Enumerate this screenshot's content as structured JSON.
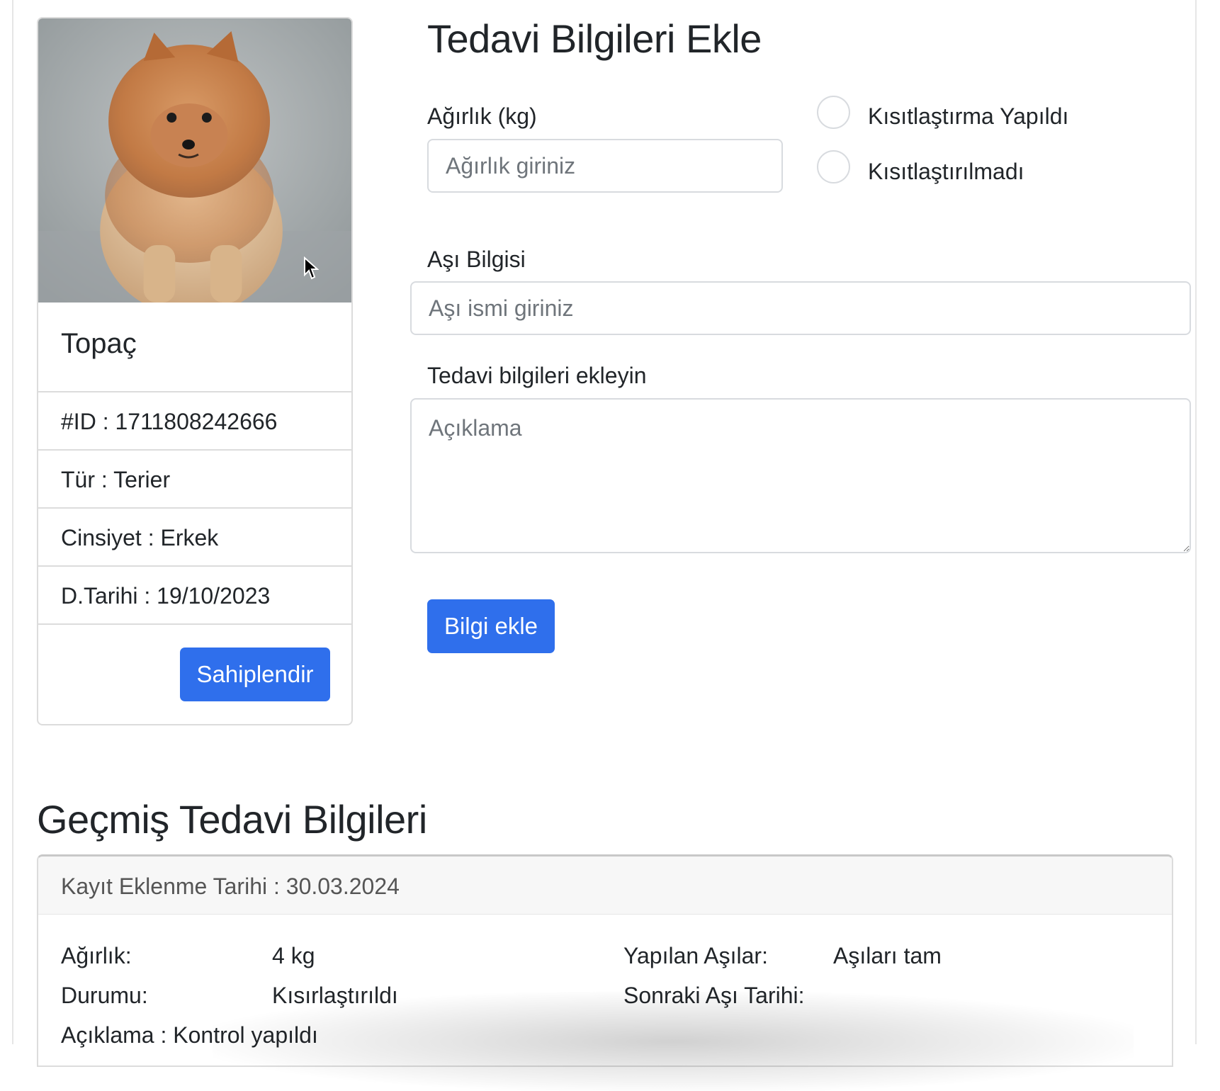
{
  "pet": {
    "name": "Topaç",
    "id_text": "#ID : 1711808242666",
    "type_text": "Tür : Terier",
    "gender_text": "Cinsiyet : Erkek",
    "birth_text": "D.Tarihi : 19/10/2023",
    "adopt_button": "Sahiplendir"
  },
  "form": {
    "title": "Tedavi Bilgileri Ekle",
    "weight_label": "Ağırlık (kg)",
    "weight_placeholder": "Ağırlık giriniz",
    "radio_neutered": "Kısıtlaştırma Yapıldı",
    "radio_not_neutered": "Kısıtlaştırılmadı",
    "vaccine_label": "Aşı Bilgisi",
    "vaccine_placeholder": "Aşı ismi giriniz",
    "treatment_label": "Tedavi bilgileri ekleyin",
    "description_placeholder": "Açıklama",
    "submit_button": "Bilgi ekle"
  },
  "history": {
    "title": "Geçmiş Tedavi Bilgileri",
    "record": {
      "date_text": "Kayıt Eklenme Tarihi : 30.03.2024",
      "weight_label": "Ağırlık:",
      "weight_value": "4 kg",
      "status_label": "Durumu:",
      "status_value": "Kısırlaştırıldı",
      "vaccines_label": "Yapılan Aşılar:",
      "vaccines_value": "Aşıları tam",
      "next_vaccine_label": "Sonraki Aşı Tarihi:",
      "next_vaccine_value": "",
      "description_text": "Açıklama : Kontrol yapıldı"
    }
  },
  "colors": {
    "primary": "#2f6fec",
    "border": "#dcdcdc",
    "header_bg": "#f7f7f7"
  }
}
